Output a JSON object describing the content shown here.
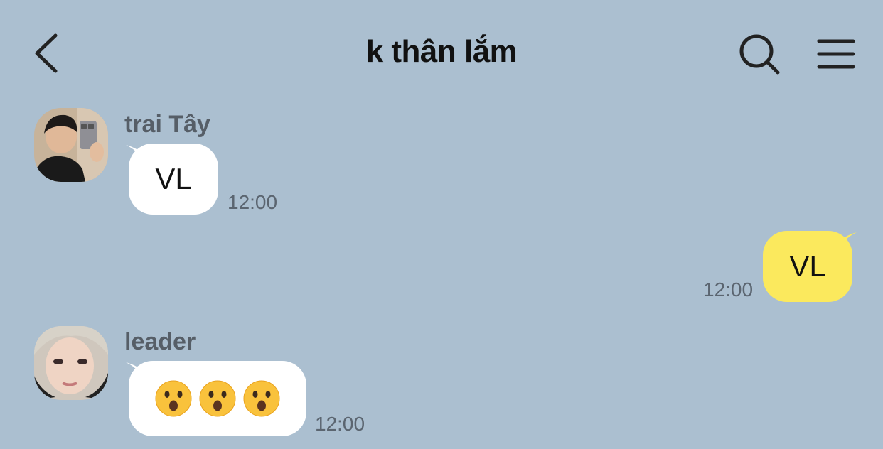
{
  "header": {
    "title": "k thân lắm",
    "back_icon": "chevron-left-icon",
    "search_icon": "search-icon",
    "menu_icon": "hamburger-menu-icon"
  },
  "colors": {
    "background": "#abbfd0",
    "incoming_bubble": "#ffffff",
    "outgoing_bubble": "#fbe95d"
  },
  "messages": [
    {
      "sender": "trai Tây",
      "text": "VL",
      "time": "12:00",
      "direction": "incoming"
    },
    {
      "sender": "",
      "text": "VL",
      "time": "12:00",
      "direction": "outgoing"
    },
    {
      "sender": "leader",
      "emoji": "hushed-face-emoji",
      "emoji_char": "😯",
      "emoji_count": 3,
      "time": "12:00",
      "direction": "incoming"
    }
  ]
}
